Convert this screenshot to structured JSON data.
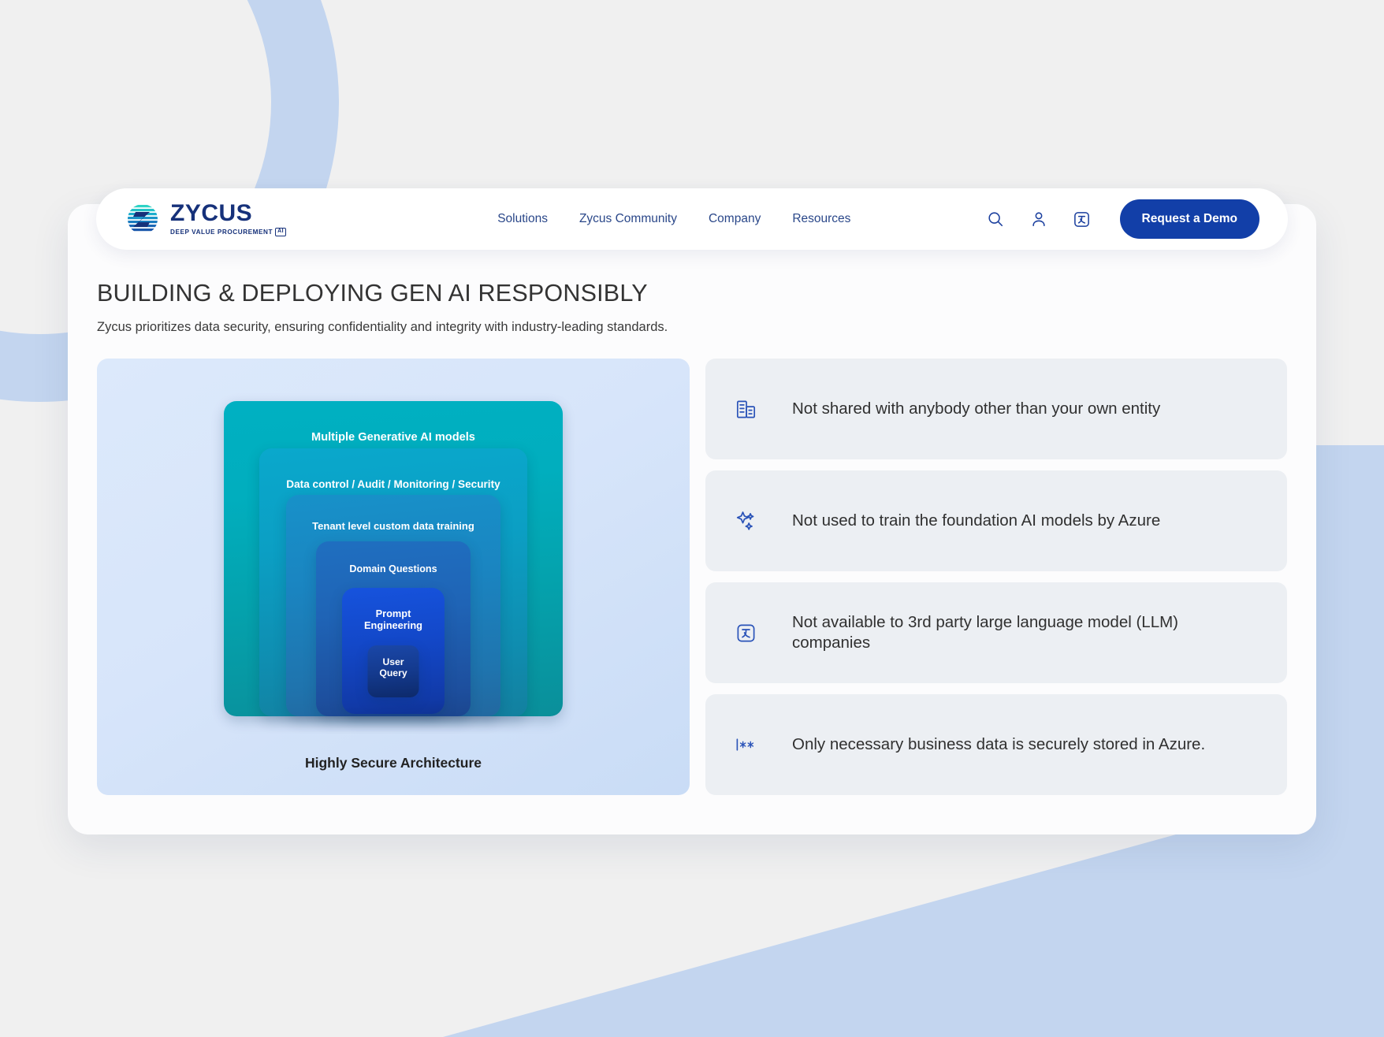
{
  "brand": {
    "logo_word": "ZYCUS",
    "logo_tagline": "DEEP VALUE PROCUREMENT",
    "logo_tagline_badge": "AI",
    "accent_blue": "#123fa8",
    "logo_navy": "#16317a",
    "nav_blue": "#2a4789"
  },
  "header": {
    "nav": [
      {
        "label": "Solutions"
      },
      {
        "label": "Zycus Community"
      },
      {
        "label": "Company"
      },
      {
        "label": "Resources"
      }
    ],
    "icons": [
      {
        "name": "search-icon"
      },
      {
        "name": "user-account-icon"
      },
      {
        "name": "translate-icon"
      }
    ],
    "cta_label": "Request a Demo"
  },
  "page": {
    "title": "BUILDING & DEPLOYING GEN AI RESPONSIBLY",
    "subtitle": "Zycus prioritizes data security, ensuring confidentiality and integrity with industry-leading standards."
  },
  "diagram": {
    "caption": "Highly Secure Architecture",
    "layers": [
      {
        "label": "Multiple Generative AI models",
        "color": "#01aebe"
      },
      {
        "label": "Data control / Audit / Monitoring / Security",
        "color": "#0b9fc4"
      },
      {
        "label": "Tenant level custom data training",
        "color": "#1a85c1"
      },
      {
        "label": "Domain Questions",
        "color": "#1f64b6"
      },
      {
        "label": "Prompt Engineering",
        "color": "#1348c9"
      },
      {
        "label": "User Query",
        "color": "#143a8e"
      }
    ]
  },
  "features": [
    {
      "icon": "building-icon",
      "text": "Not shared with anybody other than your own entity"
    },
    {
      "icon": "sparkles-icon",
      "text": "Not used to train the foundation AI models by Azure"
    },
    {
      "icon": "translate-icon",
      "text": "Not available to 3rd party large language model (LLM) companies"
    },
    {
      "icon": "password-mask-icon",
      "text": "Only necessary business data is securely stored in Azure."
    }
  ]
}
